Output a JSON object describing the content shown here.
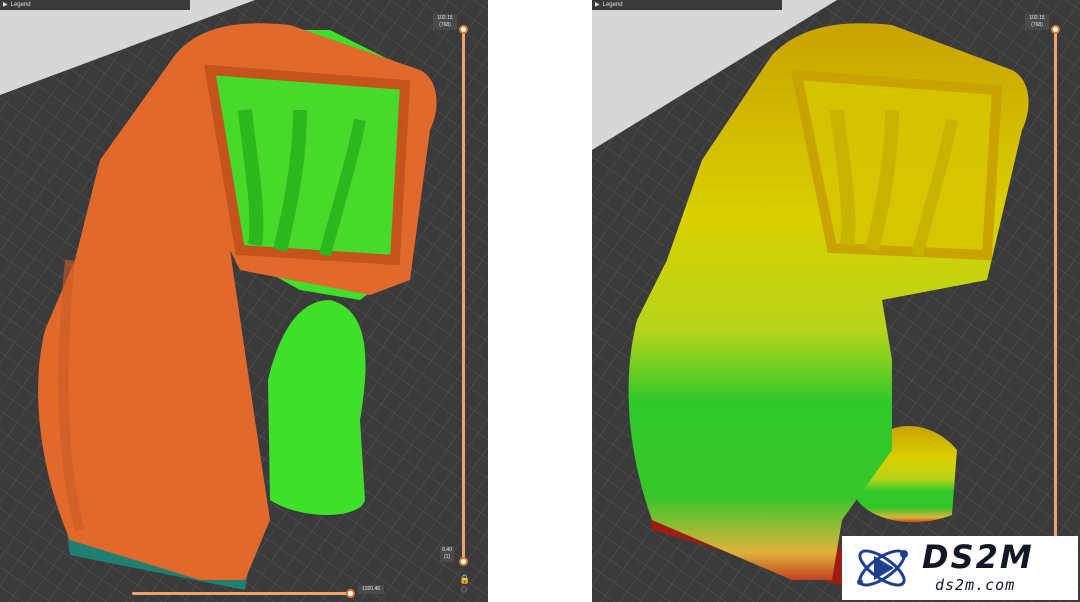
{
  "viewports": [
    {
      "id": "left",
      "legend_label": "Legend",
      "layer_top_value": "102.15",
      "layer_top_index": "(768)",
      "layer_bottom_value": "0.40",
      "layer_bottom_index": "(1)",
      "horizontal_value": "1320.46",
      "colors": {
        "model": "#e2692c",
        "support": "#3fe02a",
        "base": "#1f8072"
      }
    },
    {
      "id": "right",
      "legend_label": "Legend",
      "layer_top_value": "102.15",
      "layer_top_index": "(768)",
      "colors": {
        "gradient_top": "#d9c400",
        "gradient_mid": "#b7d51a",
        "gradient_low": "#2fc82a",
        "base": "#9c1e12"
      }
    }
  ],
  "icons": {
    "lock": "lock-icon",
    "settings": "gear-icon",
    "legend_toggle": "triangle-right-icon"
  },
  "logo": {
    "title": "DS2M",
    "subtitle": "ds2m.com"
  }
}
